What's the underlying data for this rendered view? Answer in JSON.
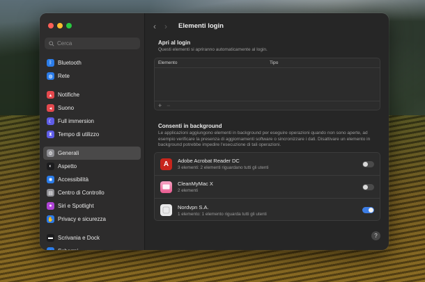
{
  "window": {
    "title": "Elementi login"
  },
  "colors": {
    "close": "#ff5f57",
    "minimize": "#febc2e",
    "zoom": "#28c840",
    "toggle_on": "#3d7ee6",
    "acrobat": "#c7251c",
    "cleanmymac": "#e85b8f"
  },
  "sidebar": {
    "search_placeholder": "Cerca",
    "groups": [
      [
        {
          "label": "Bluetooth",
          "icon": "bluetooth-icon",
          "color": "#2b7ce9"
        },
        {
          "label": "Rete",
          "icon": "globe-icon",
          "color": "#2b7ce9"
        }
      ],
      [
        {
          "label": "Notifiche",
          "icon": "bell-icon",
          "color": "#e5484d"
        },
        {
          "label": "Suono",
          "icon": "speaker-icon",
          "color": "#e5484d"
        },
        {
          "label": "Full immersion",
          "icon": "moon-icon",
          "color": "#5e5ce6"
        },
        {
          "label": "Tempo di utilizzo",
          "icon": "hourglass-icon",
          "color": "#5e5ce6"
        }
      ],
      [
        {
          "label": "Generali",
          "icon": "gear-icon",
          "color": "#8e8e93",
          "active": true
        },
        {
          "label": "Aspetto",
          "icon": "appearance-icon",
          "color": "#1c1c1e"
        },
        {
          "label": "Accessibilità",
          "icon": "accessibility-icon",
          "color": "#2b7ce9"
        },
        {
          "label": "Centro di Controllo",
          "icon": "control-center-icon",
          "color": "#8e8e93"
        },
        {
          "label": "Siri e Spotlight",
          "icon": "siri-icon",
          "color": "#b044d6"
        },
        {
          "label": "Privacy e sicurezza",
          "icon": "hand-icon",
          "color": "#2b7ce9"
        }
      ],
      [
        {
          "label": "Scrivania e Dock",
          "icon": "dock-icon",
          "color": "#1c1c1e"
        },
        {
          "label": "Schermi",
          "icon": "display-icon",
          "color": "#2b7ce9"
        }
      ]
    ]
  },
  "open_at_login": {
    "title": "Apri al login",
    "subtitle": "Questi elementi si apriranno automaticamente al login.",
    "columns": [
      "Elemento",
      "Tipo"
    ],
    "add": "+",
    "remove": "−"
  },
  "background": {
    "title": "Consenti in background",
    "subtitle": "Le applicazioni aggiungono elementi in background per eseguire operazioni quando non sono aperte, ad esempio verificare la presenza di aggiornamenti software o sincronizzare i dati. Disattivare un elemento in background potrebbe impedire l'esecuzione di tali operazioni.",
    "items": [
      {
        "name": "Adobe Acrobat Reader DC",
        "desc": "3 elementi: 2 elementi riguardano tutti gli utenti",
        "icon": "acrobat-icon",
        "enabled": false
      },
      {
        "name": "CleanMyMac X",
        "desc": "2 elementi",
        "icon": "cleanmymac-icon",
        "enabled": false
      },
      {
        "name": "Nordvpn S.A.",
        "desc": "1 elemento: 1 elemento riguarda tutti gli utenti",
        "icon": "nordvpn-icon",
        "enabled": true
      }
    ]
  },
  "help": "?"
}
